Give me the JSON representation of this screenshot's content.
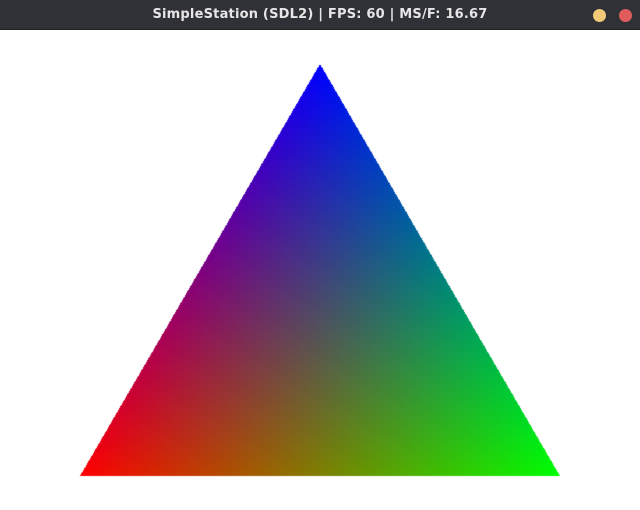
{
  "window": {
    "title": "SimpleStation (SDL2) | FPS: 60 | MS/F: 16.67",
    "buttons": {
      "minimize_color": "#f3c876",
      "close_color": "#e05b5b"
    }
  },
  "scene": {
    "background": "#ffffff",
    "vertex_colors": {
      "top": "#0000ff",
      "bottom_left": "#ff0000",
      "bottom_right": "#00ff00"
    }
  }
}
